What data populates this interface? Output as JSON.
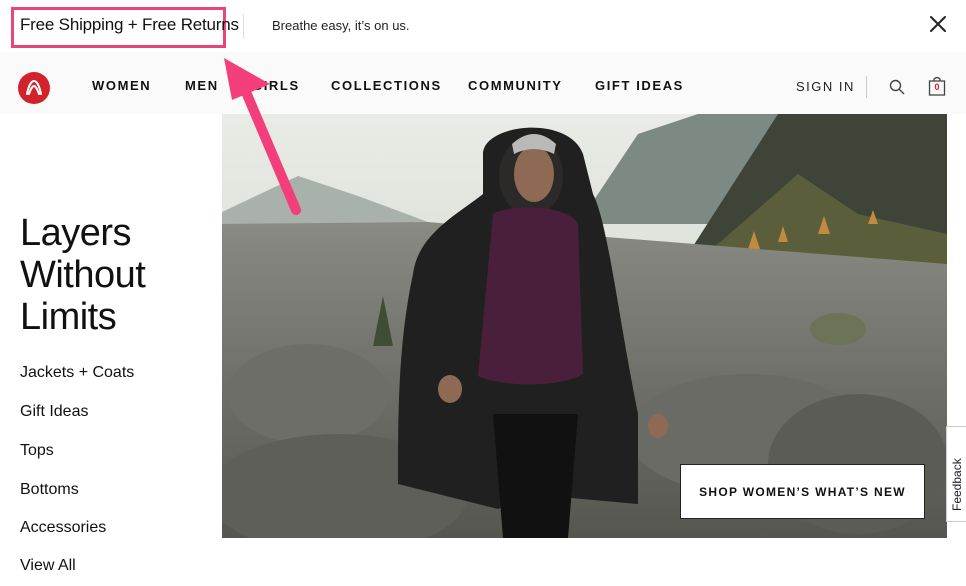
{
  "promo": {
    "title": "Free Shipping + Free Returns",
    "subtitle": "Breathe easy, it’s on us."
  },
  "header": {
    "nav": [
      "WOMEN",
      "MEN",
      "GIRLS",
      "COLLECTIONS",
      "COMMUNITY",
      "GIFT IDEAS"
    ],
    "sign_in": "SIGN IN",
    "bag_count": "0"
  },
  "left": {
    "headline": [
      "Layers",
      "Without",
      "Limits"
    ],
    "categories": [
      "Jackets + Coats",
      "Gift Ideas",
      "Tops",
      "Bottoms",
      "Accessories",
      "View All"
    ]
  },
  "hero": {
    "cta": "SHOP WOMEN’S WHAT’S NEW"
  },
  "feedback": {
    "label": "Feedback"
  },
  "colors": {
    "brand_red": "#d2232a",
    "annotation_pink": "#e8457b"
  },
  "icons": [
    "close-icon",
    "lululemon-logo",
    "search-icon",
    "shopping-bag-icon",
    "feedback-icon"
  ]
}
